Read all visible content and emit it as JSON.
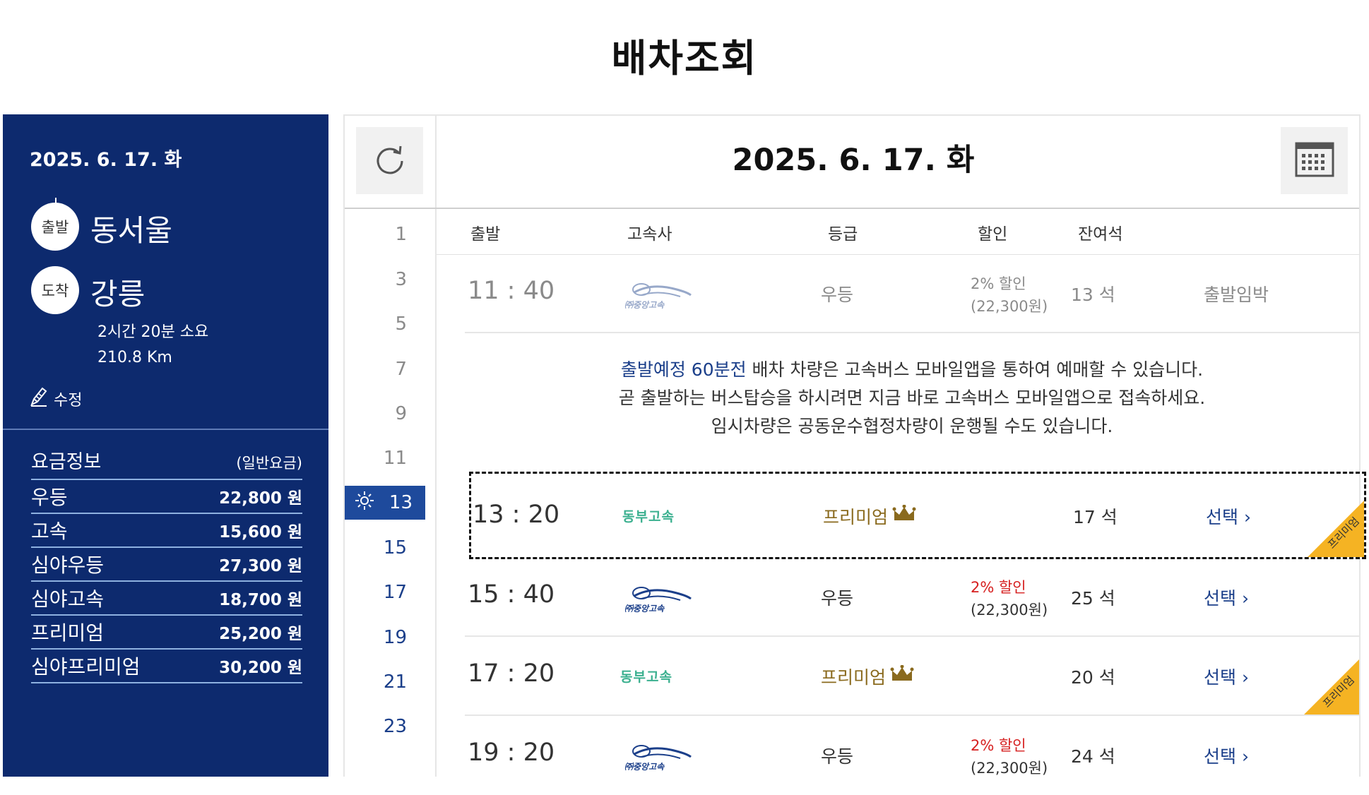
{
  "page": {
    "title": "배차조회"
  },
  "summary": {
    "date": "2025. 6. 17. 화",
    "departure_label": "출발",
    "departure_city": "동서울",
    "arrival_label": "도착",
    "arrival_city": "강릉",
    "duration": "2시간 20분 소요",
    "distance": "210.8 Km",
    "edit_label": "수정"
  },
  "fares": {
    "title": "요금정보",
    "subtitle": "(일반요금)",
    "rows": [
      {
        "name": "우등",
        "price": "22,800 원"
      },
      {
        "name": "고속",
        "price": "15,600 원"
      },
      {
        "name": "심야우등",
        "price": "27,300 원"
      },
      {
        "name": "심야고속",
        "price": "18,700 원"
      },
      {
        "name": "프리미엄",
        "price": "25,200 원"
      },
      {
        "name": "심야프리미엄",
        "price": "30,200 원"
      }
    ]
  },
  "schedule": {
    "date_title": "2025. 6. 17. 화",
    "hours": [
      "1",
      "3",
      "5",
      "7",
      "9",
      "11",
      "13",
      "15",
      "17",
      "19",
      "21",
      "23"
    ],
    "columns": {
      "departure": "출발",
      "company": "고속사",
      "grade": "등급",
      "discount": "할인",
      "seats": "잔여석"
    },
    "rows": [
      {
        "time": "11 : 40",
        "company": "중앙고속",
        "grade": "우등",
        "discount_pct": "2% 할인",
        "discount_amt": "(22,300원)",
        "seats": "13 석",
        "status": "출발임박"
      },
      {
        "time": "13 : 20",
        "company": "동부고속",
        "grade": "프리미엄",
        "discount_pct": "",
        "discount_amt": "",
        "seats": "17 석",
        "action": "선택",
        "ribbon": "프리미엄"
      },
      {
        "time": "15 : 40",
        "company": "중앙고속",
        "grade": "우등",
        "discount_pct": "2% 할인",
        "discount_amt": "(22,300원)",
        "seats": "25 석",
        "action": "선택"
      },
      {
        "time": "17 : 20",
        "company": "동부고속",
        "grade": "프리미엄",
        "discount_pct": "",
        "discount_amt": "",
        "seats": "20 석",
        "action": "선택",
        "ribbon": "프리미엄"
      },
      {
        "time": "19 : 20",
        "company": "중앙고속",
        "grade": "우등",
        "discount_pct": "2% 할인",
        "discount_amt": "(22,300원)",
        "seats": "24 석",
        "action": "선택"
      }
    ],
    "notice": {
      "highlight": "출발예정 60분전",
      "line1_rest": " 배차 차량은 고속버스 모바일앱을 통하여 예매할 수 있습니다.",
      "line2": "곧 출발하는 버스탑승을 하시려면 지금 바로 고속버스 모바일앱으로 접속하세요.",
      "line3": "임시차량은 공동운수협정차량이 운행될 수도 있습니다."
    }
  },
  "colors": {
    "panel": "#0d2a6e",
    "accent": "#1b3f8a",
    "discount": "#d62020",
    "premium": "#8a6a1e",
    "ribbon": "#f5b323"
  },
  "icons": {
    "refresh": "refresh-icon",
    "calendar": "calendar-icon",
    "edit": "edit-icon",
    "sun": "sun-icon",
    "crown": "crown-icon",
    "chevron": "chevron-right-icon"
  }
}
